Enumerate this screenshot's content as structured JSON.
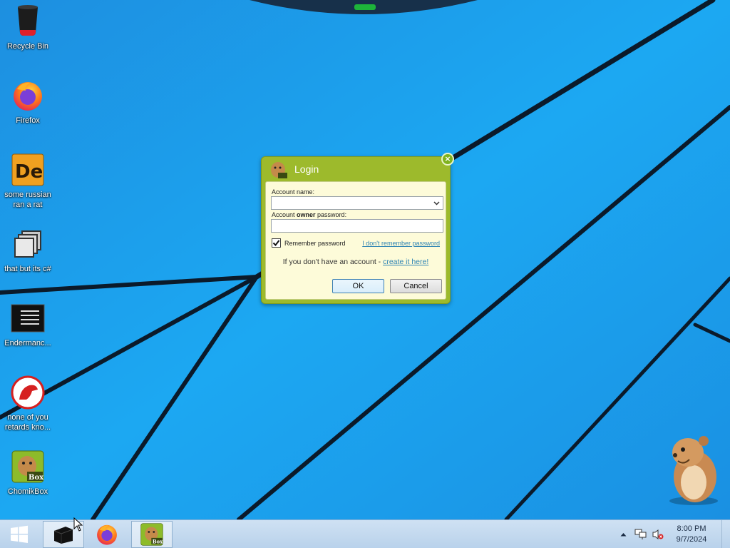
{
  "desktop": {
    "icons": [
      {
        "label": "Recycle Bin",
        "icon": "recycle-bin-icon"
      },
      {
        "label": "Firefox",
        "icon": "firefox-icon"
      },
      {
        "label": "some russian ran a rat",
        "icon": "de-app-icon"
      },
      {
        "label": "that but its c#",
        "icon": "windows-stack-icon"
      },
      {
        "label": "Endermanc...",
        "icon": "terminal-icon"
      },
      {
        "label": "none of you retards kno...",
        "icon": "dinosaur-icon"
      },
      {
        "label": "ChomikBox",
        "icon": "chomikbox-icon"
      }
    ],
    "mascot": "hamster-mascot"
  },
  "login_dialog": {
    "title": "Login",
    "close_icon": "close-icon",
    "account_name_label": "Account name:",
    "account_name_value": "",
    "password_label_prefix": "Account ",
    "password_label_bold": "owner",
    "password_label_suffix": " password:",
    "password_value": "",
    "remember_password_label": "Remember password",
    "remember_password_checked": true,
    "forgot_link": "I don't remember password",
    "no_account_text": "If you don't have an account - ",
    "create_link": "create it here!",
    "ok_label": "OK",
    "cancel_label": "Cancel"
  },
  "taskbar": {
    "start_icon": "windows-start-icon",
    "items": [
      {
        "name": "black-box-app",
        "icon": "black-box-icon"
      },
      {
        "name": "firefox",
        "icon": "firefox-icon"
      },
      {
        "name": "chomikbox",
        "icon": "chomikbox-icon",
        "active": true
      }
    ],
    "tray_icons": [
      "chevron-up-icon",
      "network-icon",
      "volume-muted-icon"
    ],
    "time": "8:00 PM",
    "date": "9/7/2024"
  },
  "colors": {
    "wallpaper": "#1a9ff0",
    "dialog_frame": "#9dba2c",
    "dialog_panel": "#fdfbd9",
    "link": "#2f84b4"
  }
}
